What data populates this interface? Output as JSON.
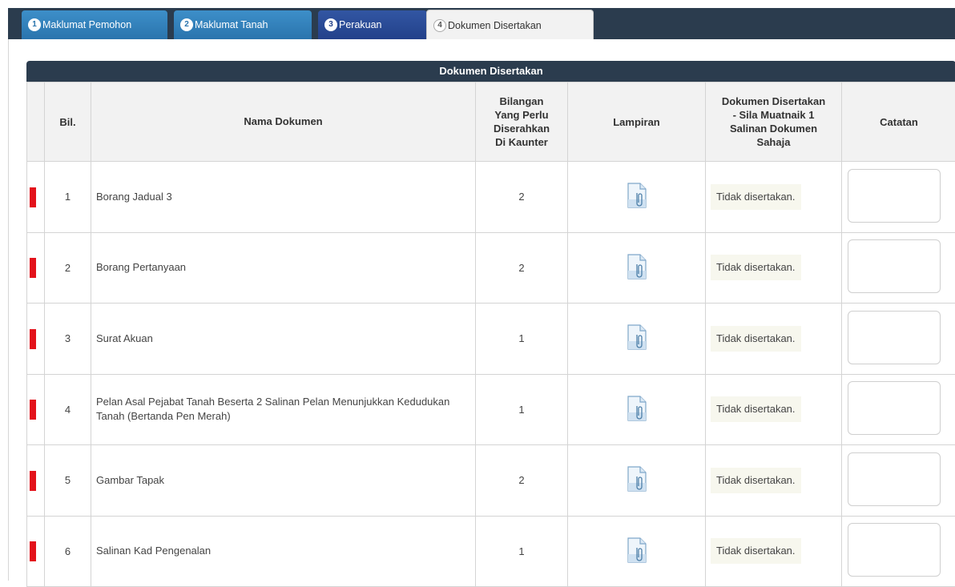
{
  "tabs": [
    {
      "num": "1",
      "label": "Maklumat Pemohon"
    },
    {
      "num": "2",
      "label": "Maklumat Tanah"
    },
    {
      "num": "3",
      "label": "Perakuan"
    },
    {
      "num": "4",
      "label": "Dokumen Disertakan"
    }
  ],
  "section_title": "Dokumen Disertakan",
  "columns": {
    "bil": "Bil.",
    "nama": "Nama Dokumen",
    "bilangan_l1": "Bilangan",
    "bilangan_l2": "Yang Perlu",
    "bilangan_l3": "Diserahkan",
    "bilangan_l4": "Di Kaunter",
    "lampiran": "Lampiran",
    "dok_l1": "Dokumen Disertakan",
    "dok_l2": "- Sila Muatnaik 1",
    "dok_l3": "Salinan Dokumen",
    "dok_l4": "Sahaja",
    "catatan": "Catatan"
  },
  "rows": [
    {
      "bil": "1",
      "name": "Borang Jadual 3",
      "qty": "2",
      "status": "Tidak disertakan."
    },
    {
      "bil": "2",
      "name": "Borang Pertanyaan",
      "qty": "2",
      "status": "Tidak disertakan."
    },
    {
      "bil": "3",
      "name": "Surat Akuan",
      "qty": "1",
      "status": "Tidak disertakan."
    },
    {
      "bil": "4",
      "name": "Pelan Asal Pejabat Tanah Beserta 2 Salinan Pelan Menunjukkan Kedudukan Tanah (Bertanda Pen Merah)",
      "qty": "1",
      "status": "Tidak disertakan."
    },
    {
      "bil": "5",
      "name": "Gambar Tapak",
      "qty": "2",
      "status": "Tidak disertakan."
    },
    {
      "bil": "6",
      "name": "Salinan Kad Pengenalan",
      "qty": "1",
      "status": "Tidak disertakan."
    }
  ],
  "icons": {
    "attachment": "file-attachment-icon",
    "required_flag": "required-flag-icon"
  },
  "colors": {
    "header_bg": "#2b3c4e",
    "tab_blue": "#2a74ad",
    "tab_navy": "#23418a",
    "flag_red": "#e3121b"
  }
}
